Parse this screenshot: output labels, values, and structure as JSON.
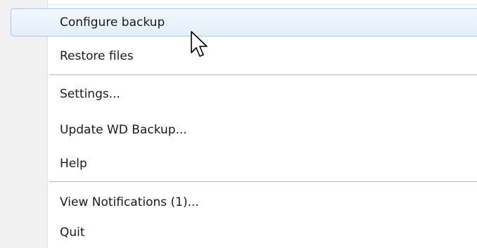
{
  "menu": {
    "items": [
      {
        "label": "Configure backup"
      },
      {
        "label": "Restore files"
      },
      {
        "label": "Settings..."
      },
      {
        "label": "Update WD Backup..."
      },
      {
        "label": "Help"
      },
      {
        "label": "View Notifications (1)..."
      },
      {
        "label": "Quit"
      }
    ],
    "highlighted_item": "Configure backup"
  },
  "colors": {
    "gutter": "#f1f1f1",
    "highlight_border": "#a8cae6",
    "highlight_fill": "#e4effa",
    "text": "#1a1a1a"
  },
  "icons": {
    "pointer": "mouse-pointer-icon"
  }
}
